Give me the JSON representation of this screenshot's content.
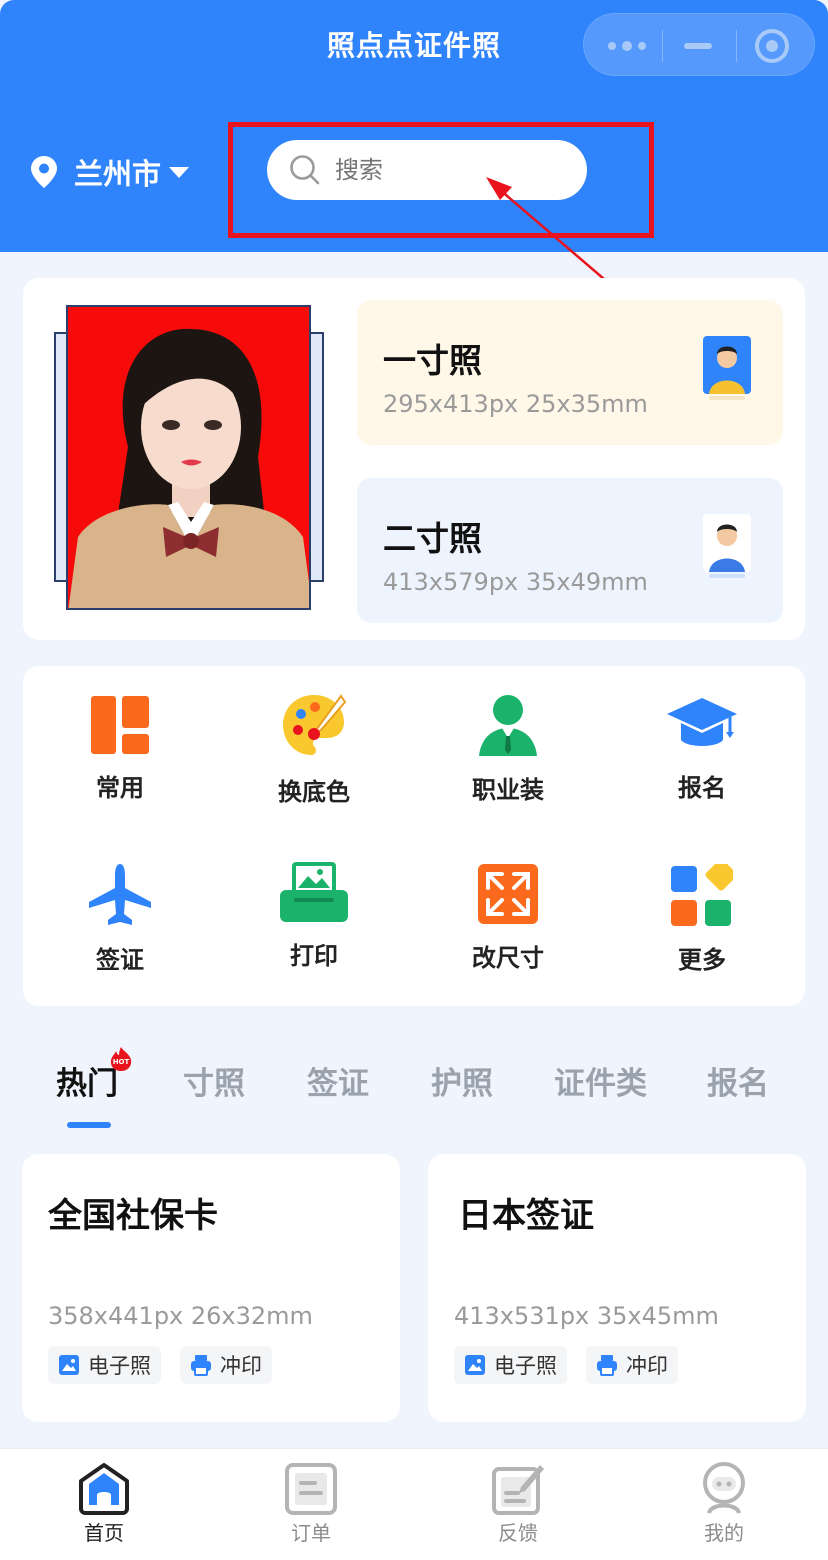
{
  "nav": {
    "title": "照点点证件照"
  },
  "location": {
    "city": "兰州市"
  },
  "search": {
    "placeholder": "搜索"
  },
  "hero": {
    "sizes": [
      {
        "name": "一寸照",
        "spec": "295x413px 25x35mm"
      },
      {
        "name": "二寸照",
        "spec": "413x579px 35x49mm"
      }
    ]
  },
  "features": [
    {
      "label": "常用",
      "icon": "grid-icon"
    },
    {
      "label": "换底色",
      "icon": "palette-icon"
    },
    {
      "label": "职业装",
      "icon": "suit-icon"
    },
    {
      "label": "报名",
      "icon": "graduation-cap-icon"
    },
    {
      "label": "签证",
      "icon": "airplane-icon"
    },
    {
      "label": "打印",
      "icon": "printer-icon"
    },
    {
      "label": "改尺寸",
      "icon": "resize-icon"
    },
    {
      "label": "更多",
      "icon": "more-apps-icon"
    }
  ],
  "tabs": [
    "热门",
    "寸照",
    "签证",
    "护照",
    "证件类",
    "报名"
  ],
  "hot_badge": "HOT",
  "items": [
    {
      "title": "全国社保卡",
      "spec": "358x441px 26x32mm",
      "tags": [
        "电子照",
        "冲印"
      ]
    },
    {
      "title": "日本签证",
      "spec": "413x531px 35x45mm",
      "tags": [
        "电子照",
        "冲印"
      ]
    }
  ],
  "tabbar": [
    "首页",
    "订单",
    "反馈",
    "我的"
  ],
  "colors": {
    "primary": "#2f83fb",
    "highlight": "#e8131c",
    "orange": "#fb6a1c",
    "green": "#1bb36b"
  }
}
